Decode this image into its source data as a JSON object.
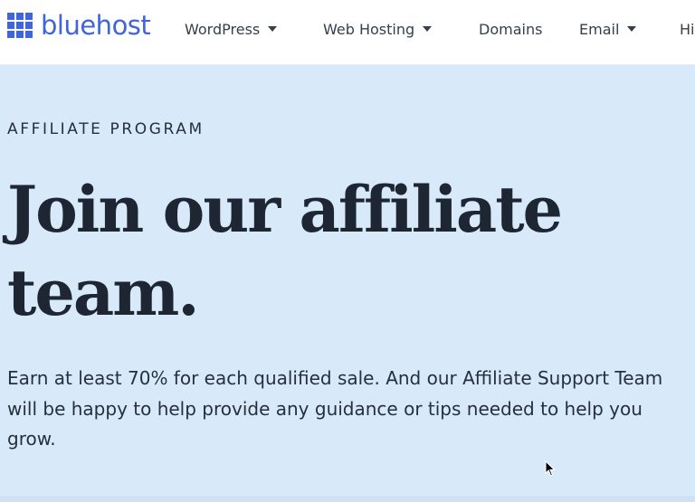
{
  "header": {
    "logo_text": "bluehost",
    "nav": [
      {
        "label": "WordPress",
        "has_dropdown": true
      },
      {
        "label": "Web Hosting",
        "has_dropdown": true
      },
      {
        "label": "Domains",
        "has_dropdown": false
      },
      {
        "label": "Email",
        "has_dropdown": true
      },
      {
        "label": "Hi",
        "has_dropdown": false
      }
    ]
  },
  "hero": {
    "eyebrow": "AFFILIATE PROGRAM",
    "headline": "Join our affiliate team.",
    "description": "Earn at least 70% for each qualified sale. And our Affiliate Support Team will be happy to help provide any guidance or tips needed to help you grow."
  },
  "colors": {
    "brand_blue": "#3f65d8",
    "hero_background": "#d8eaf9",
    "heading_text": "#1e2633"
  },
  "icons": {
    "logo": "grid-logo-icon",
    "dropdown": "caret-down-icon",
    "pointer": "mouse-pointer-icon"
  }
}
